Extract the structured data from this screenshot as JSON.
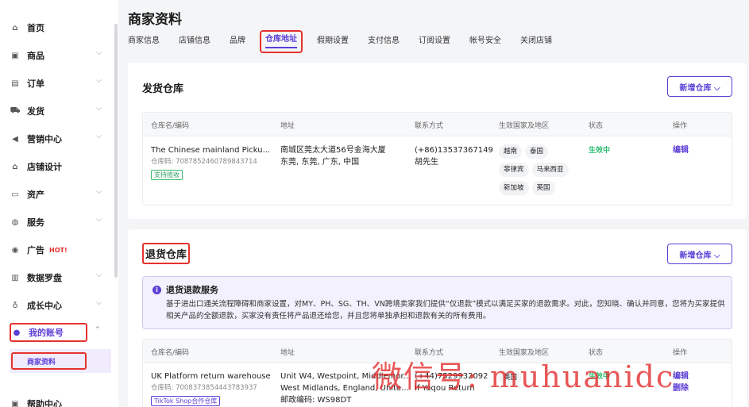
{
  "sidebar": {
    "items": [
      {
        "label": "首页",
        "icon": "home-icon",
        "chevron": ""
      },
      {
        "label": "商品",
        "icon": "box-icon",
        "chevron": "⌵"
      },
      {
        "label": "订单",
        "icon": "list-icon",
        "chevron": "⌵"
      },
      {
        "label": "发货",
        "icon": "truck-icon",
        "chevron": "⌵"
      },
      {
        "label": "营销中心",
        "icon": "megaphone-icon",
        "chevron": "⌵"
      },
      {
        "label": "店铺设计",
        "icon": "store-icon",
        "chevron": ""
      },
      {
        "label": "资产",
        "icon": "card-icon",
        "chevron": "⌵"
      },
      {
        "label": "服务",
        "icon": "globe-icon",
        "chevron": "⌵"
      },
      {
        "label": "广告",
        "icon": "ad-icon",
        "chevron": "",
        "badge": "HOT!"
      },
      {
        "label": "数据罗盘",
        "icon": "bar-chart-icon",
        "chevron": "⌵"
      },
      {
        "label": "成长中心",
        "icon": "medal-icon",
        "chevron": "⌵"
      },
      {
        "label": "我的账号",
        "icon": "user-icon",
        "chevron": "⌃"
      },
      {
        "label": "帮助中心",
        "icon": "help-icon",
        "chevron": ""
      }
    ],
    "sub_item": "商家资料"
  },
  "page": {
    "title": "商家资料",
    "tabs": [
      "商家信息",
      "店铺信息",
      "品牌",
      "仓库地址",
      "假期设置",
      "支付信息",
      "订阅设置",
      "帐号安全",
      "关闭店铺"
    ],
    "active_tab": "仓库地址"
  },
  "shipping": {
    "title": "发货仓库",
    "new_button": "新增仓库 ⌵",
    "headers": [
      "仓库名/编码",
      "地址",
      "联系方式",
      "生效国家及地区",
      "状态",
      "操作"
    ],
    "row": {
      "name": "The Chinese mainland Picku...",
      "code": "仓库码: 7087852460789843714",
      "tag": "支持揽收",
      "address_1": "南城区莞太大道56号金海大厦",
      "address_2": "东莞, 东莞, 广东, 中国",
      "phone": "(+86)13537367149",
      "contact": "胡先生",
      "regions": [
        "越南",
        "泰国",
        "菲律宾",
        "马来西亚",
        "新加坡",
        "英国"
      ],
      "status": "生效中",
      "action": "编辑"
    }
  },
  "returns": {
    "title": "退货仓库",
    "new_button": "新增仓库 ⌵",
    "notice_title": "退货退款服务",
    "notice_text": "基于进出口通关流程障碍和商家设置，对MY、PH、SG、TH、VN跨境卖家我们提供“仅退款”模式以满足买家的退款需求。对此，您知晓、确认并同意，您将为买家提供相关产品的全额退款，买家没有责任将产品退还给您，并且您将单独承担和退款有关的所有费用。",
    "headers": [
      "仓库名/编码",
      "地址",
      "联系方式",
      "生效国家及地区",
      "状态",
      "操作"
    ],
    "row": {
      "name": "UK Platform return warehouse",
      "code": "仓库码: 7008373854443783937",
      "tag": "TikTok Shop合作仓库",
      "address_1": "Unit W4, Westpoint, Middlemor...",
      "address_2": "West Midlands, England, Unite...",
      "address_3": "邮政编码: WS98DT",
      "phone": "(+44)7529932092",
      "contact": "If Yoqou Return",
      "regions": [
        "英国"
      ],
      "status": "生效中",
      "action_1": "编辑",
      "action_2": "删除"
    }
  },
  "watermark": "微信号: muhuanidc",
  "colors": {
    "accent": "#5b3fd6",
    "highlight_box": "#e5322d",
    "success": "#2bbd6e"
  }
}
